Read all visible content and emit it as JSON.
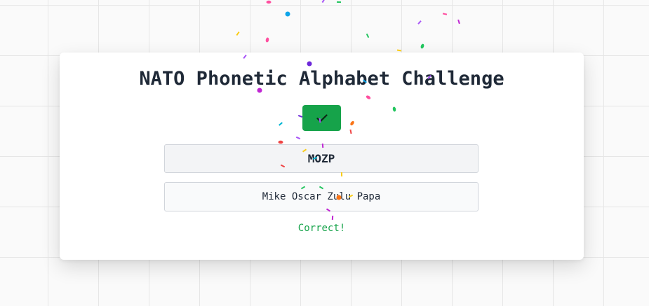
{
  "card": {
    "title": "NATO Phonetic Alphabet Challenge",
    "check_button_icon": "checkmark-icon",
    "code": "MOZP",
    "answer_value": "Mike Oscar Zulu Papa",
    "feedback": "Correct!"
  },
  "colors": {
    "accent_green": "#16a34a",
    "title_text": "#1f2937"
  },
  "confetti_colors": [
    "#ff4fa0",
    "#a855f7",
    "#22c55e",
    "#0ea5e9",
    "#facc15",
    "#f97316",
    "#ef4444",
    "#6d28d9",
    "#c026d3",
    "#06b6d4"
  ]
}
